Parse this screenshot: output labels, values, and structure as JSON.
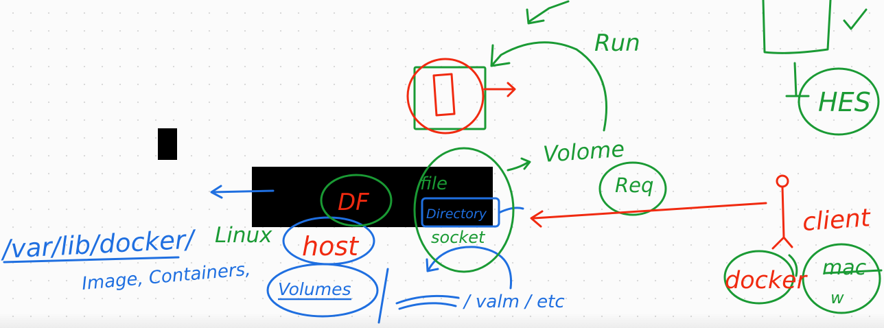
{
  "colors": {
    "blue": "#1f6fe0",
    "green": "#1a9a34",
    "red": "#f02a10",
    "black": "#000000"
  },
  "labels": {
    "run": "Run",
    "hes": "HES",
    "volume": "Volome",
    "req": "Req",
    "client": "client",
    "df": "DF",
    "file": "file",
    "directory": "Directory",
    "socket": "socket",
    "host": "host",
    "volumes": "Volumes",
    "path": "/var/lib/docker/",
    "linux": "Linux",
    "image_line": "Image, Containers,",
    "valum": "/ valm / etc",
    "docker": "docker",
    "mac": "mac",
    "mac_w": "w"
  }
}
